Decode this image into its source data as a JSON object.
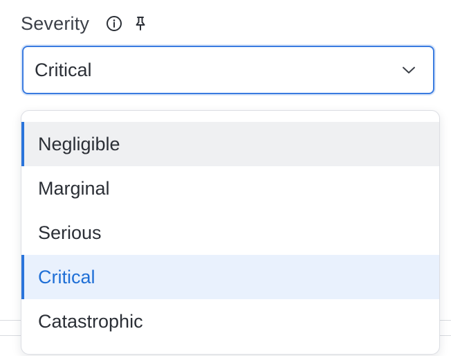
{
  "field": {
    "label": "Severity",
    "info_icon": "info-circle-icon",
    "pin_icon": "pin-icon"
  },
  "select": {
    "value": "Critical",
    "chevron_icon": "chevron-down-icon",
    "focus_color": "#3a7be0"
  },
  "menu": {
    "items": [
      {
        "label": "Negligible",
        "state": "hover"
      },
      {
        "label": "Marginal",
        "state": "default"
      },
      {
        "label": "Serious",
        "state": "default"
      },
      {
        "label": "Critical",
        "state": "selected"
      },
      {
        "label": "Catastrophic",
        "state": "default"
      }
    ],
    "selected_text_color": "#1f6fd6",
    "selected_bg_color": "#e9f1fd",
    "hover_bg_color": "#eff0f2",
    "indicator_color": "#2a74db"
  }
}
